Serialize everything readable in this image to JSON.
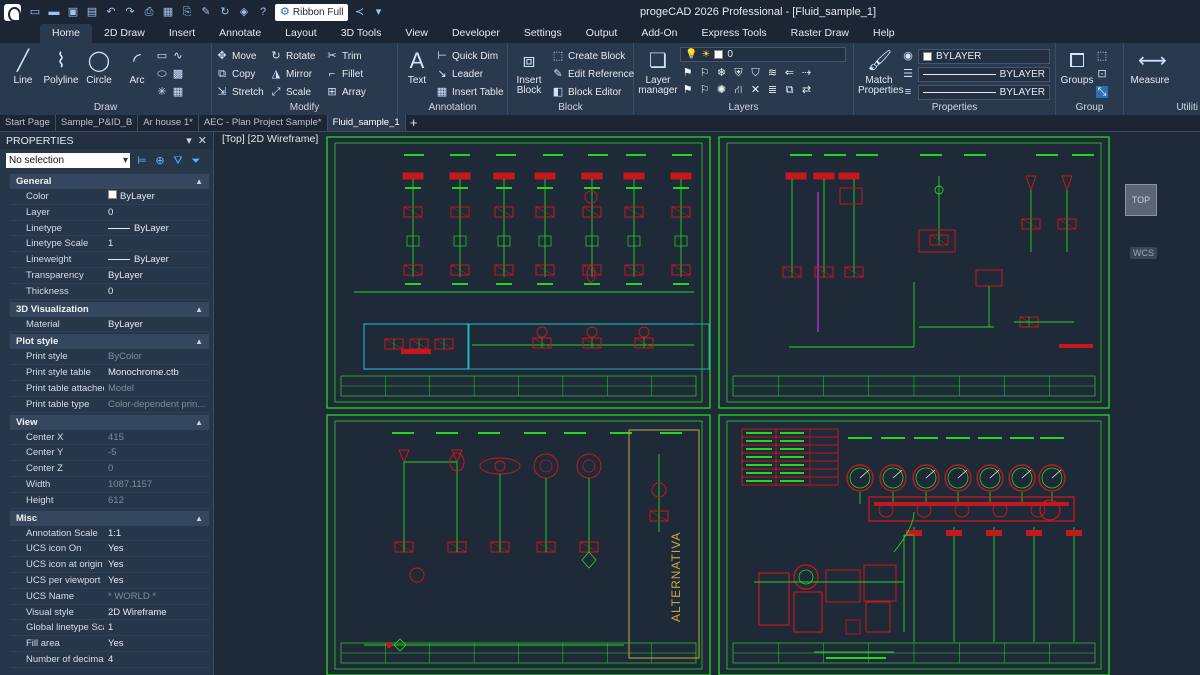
{
  "app": {
    "window_title": "progeCAD 2026 Professional - [Fluid_sample_1]",
    "ribbon_mode": "Ribbon Full"
  },
  "menu_tabs": [
    "Home",
    "2D Draw",
    "Insert",
    "Annotate",
    "Layout",
    "3D Tools",
    "View",
    "Developer",
    "Settings",
    "Output",
    "Add-On",
    "Express Tools",
    "Raster Draw",
    "Help"
  ],
  "ribbon": {
    "draw": {
      "title": "Draw",
      "line": "Line",
      "polyline": "Polyline",
      "circle": "Circle",
      "arc": "Arc"
    },
    "modify": {
      "title": "Modify",
      "move": "Move",
      "rotate": "Rotate",
      "trim": "Trim",
      "copy": "Copy",
      "mirror": "Mirror",
      "fillet": "Fillet",
      "stretch": "Stretch",
      "scale": "Scale",
      "array": "Array"
    },
    "annotation": {
      "title": "Annotation",
      "text": "Text",
      "quick_dim": "Quick Dim",
      "leader": "Leader",
      "insert_table": "Insert Table"
    },
    "block": {
      "title": "Block",
      "insert_block": "Insert Block",
      "create_block": "Create Block",
      "edit_reference": "Edit Reference",
      "block_editor": "Block Editor"
    },
    "layers": {
      "title": "Layers",
      "layer_manager": "Layer manager",
      "current_layer": "0"
    },
    "properties": {
      "title": "Properties",
      "match_properties": "Match Properties",
      "color": "BYLAYER",
      "linetype": "BYLAYER",
      "lineweight": "BYLAYER"
    },
    "group": {
      "title": "Group",
      "groups": "Groups"
    },
    "utilities": {
      "title": "Utiliti",
      "measure": "Measure"
    }
  },
  "doc_tabs": [
    "Start Page",
    "Sample_P&ID_B",
    "Ar house 1*",
    "AEC - Plan Project Sample*",
    "Fluid_sample_1"
  ],
  "doc_tab_add": "+",
  "properties": {
    "title": "PROPERTIES",
    "selection": "No selection",
    "categories": [
      {
        "name": "General",
        "rows": [
          {
            "k": "Color",
            "v": "ByLayer"
          },
          {
            "k": "Layer",
            "v": "0"
          },
          {
            "k": "Linetype",
            "v": "ByLayer"
          },
          {
            "k": "Linetype Scale",
            "v": "1"
          },
          {
            "k": "Lineweight",
            "v": "ByLayer"
          },
          {
            "k": "Transparency",
            "v": "ByLayer"
          },
          {
            "k": "Thickness",
            "v": "0"
          }
        ]
      },
      {
        "name": "3D Visualization",
        "rows": [
          {
            "k": "Material",
            "v": "ByLayer"
          }
        ]
      },
      {
        "name": "Plot style",
        "rows": [
          {
            "k": "Print style",
            "v": "ByColor"
          },
          {
            "k": "Print style table",
            "v": "Monochrome.ctb"
          },
          {
            "k": "Print table attached to",
            "v": "Model"
          },
          {
            "k": "Print table type",
            "v": "Color-dependent prin..."
          }
        ]
      },
      {
        "name": "View",
        "rows": [
          {
            "k": "Center X",
            "v": "415"
          },
          {
            "k": "Center Y",
            "v": "-5"
          },
          {
            "k": "Center Z",
            "v": "0"
          },
          {
            "k": "Width",
            "v": "1087.1157"
          },
          {
            "k": "Height",
            "v": "612"
          }
        ]
      },
      {
        "name": "Misc",
        "rows": [
          {
            "k": "Annotation Scale",
            "v": "1:1"
          },
          {
            "k": "UCS icon On",
            "v": "Yes"
          },
          {
            "k": "UCS icon at origin",
            "v": "Yes"
          },
          {
            "k": "UCS per viewport",
            "v": "Yes"
          },
          {
            "k": "UCS Name",
            "v": "* WORLD *"
          },
          {
            "k": "Visual style",
            "v": "2D Wireframe"
          },
          {
            "k": "Global linetype Scale",
            "v": "1"
          },
          {
            "k": "Fill area",
            "v": "Yes"
          },
          {
            "k": "Number of decimal pl",
            "v": "4"
          }
        ]
      }
    ]
  },
  "canvas": {
    "view_label": "[Top] [2D Wireframe]",
    "viewcube": "TOP",
    "wcs": "WCS",
    "drawing_text": "ALTERNATIVA"
  },
  "colors": {
    "accent": "#2f6fb5",
    "cad_green": "#24d61f",
    "cad_red": "#c8161d",
    "cad_cyan": "#1fc7d6",
    "cad_magenta": "#c838e0"
  }
}
